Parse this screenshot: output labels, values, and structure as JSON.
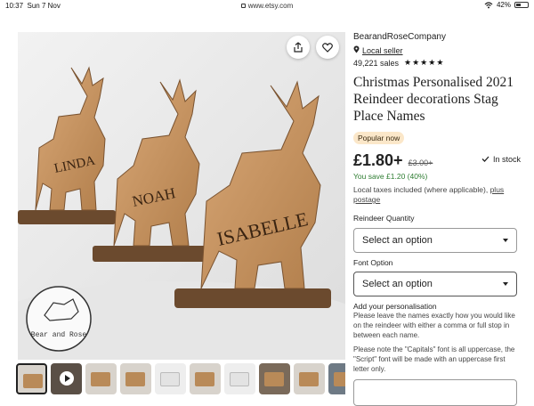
{
  "status_bar": {
    "time": "10:37",
    "date": "Sun 7 Nov",
    "url": "www.etsy.com",
    "battery": "42%",
    "battery_level": 0.42
  },
  "gallery": {
    "main_image_alt": "Wooden reindeer place names",
    "names_on_reindeer": [
      "LINDA",
      "NOAH",
      "ISABELLE"
    ],
    "logo_text": "Bear and Rose",
    "thumbnails_count": 10,
    "active_thumbnail": 1
  },
  "product": {
    "shop_name": "BearandRoseCompany",
    "local_seller": "Local seller",
    "sales": "49,221 sales",
    "rating_stars": "★★★★★",
    "title": "Christmas Personalised 2021 Reindeer decorations Stag Place Names",
    "badge": "Popular now",
    "price": "£1.80+",
    "old_price": "£3.00+",
    "stock": "In stock",
    "savings": "You save £1.20 (40%)",
    "taxes_text": "Local taxes included (where applicable),",
    "taxes_link": "plus postage"
  },
  "options": {
    "quantity_label": "Reindeer Quantity",
    "quantity_value": "Select an option",
    "font_label": "Font Option",
    "font_value": "Select an option"
  },
  "personalisation": {
    "label": "Add your personalisation",
    "help1": "Please leave the names exactly how you would like on the reindeer with either a comma or full stop in between each name.",
    "help2": "Please note the \"Capitals\" font is all uppercase, the \"Script\" font will be made with an uppercase first letter only."
  }
}
